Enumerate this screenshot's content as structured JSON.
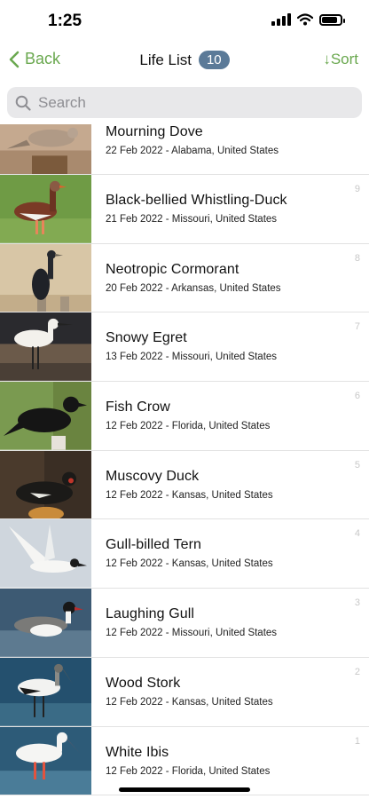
{
  "status": {
    "time": "1:25"
  },
  "nav": {
    "back_label": "Back",
    "title": "Life List",
    "count": "10",
    "sort_label": "↓Sort"
  },
  "search": {
    "placeholder": "Search"
  },
  "birds": [
    {
      "name": "Mourning Dove",
      "meta": "22 Feb 2022 - Alabama, United States",
      "num": ""
    },
    {
      "name": "Black-bellied Whistling-Duck",
      "meta": "21 Feb 2022 - Missouri, United States",
      "num": "9"
    },
    {
      "name": "Neotropic Cormorant",
      "meta": "20 Feb 2022 - Arkansas, United States",
      "num": "8"
    },
    {
      "name": "Snowy Egret",
      "meta": "13 Feb 2022 - Missouri, United States",
      "num": "7"
    },
    {
      "name": "Fish Crow",
      "meta": "12 Feb 2022 - Florida, United States",
      "num": "6"
    },
    {
      "name": "Muscovy Duck",
      "meta": "12 Feb 2022 - Kansas, United States",
      "num": "5"
    },
    {
      "name": "Gull-billed Tern",
      "meta": "12 Feb 2022 - Kansas, United States",
      "num": "4"
    },
    {
      "name": "Laughing Gull",
      "meta": "12 Feb 2022 - Missouri, United States",
      "num": "3"
    },
    {
      "name": "Wood Stork",
      "meta": "12 Feb 2022 - Kansas, United States",
      "num": "2"
    },
    {
      "name": "White Ibis",
      "meta": "12 Feb 2022 - Florida, United States",
      "num": "1"
    }
  ],
  "colors": {
    "accent": "#6aa84f",
    "badge": "#5b7a98"
  }
}
